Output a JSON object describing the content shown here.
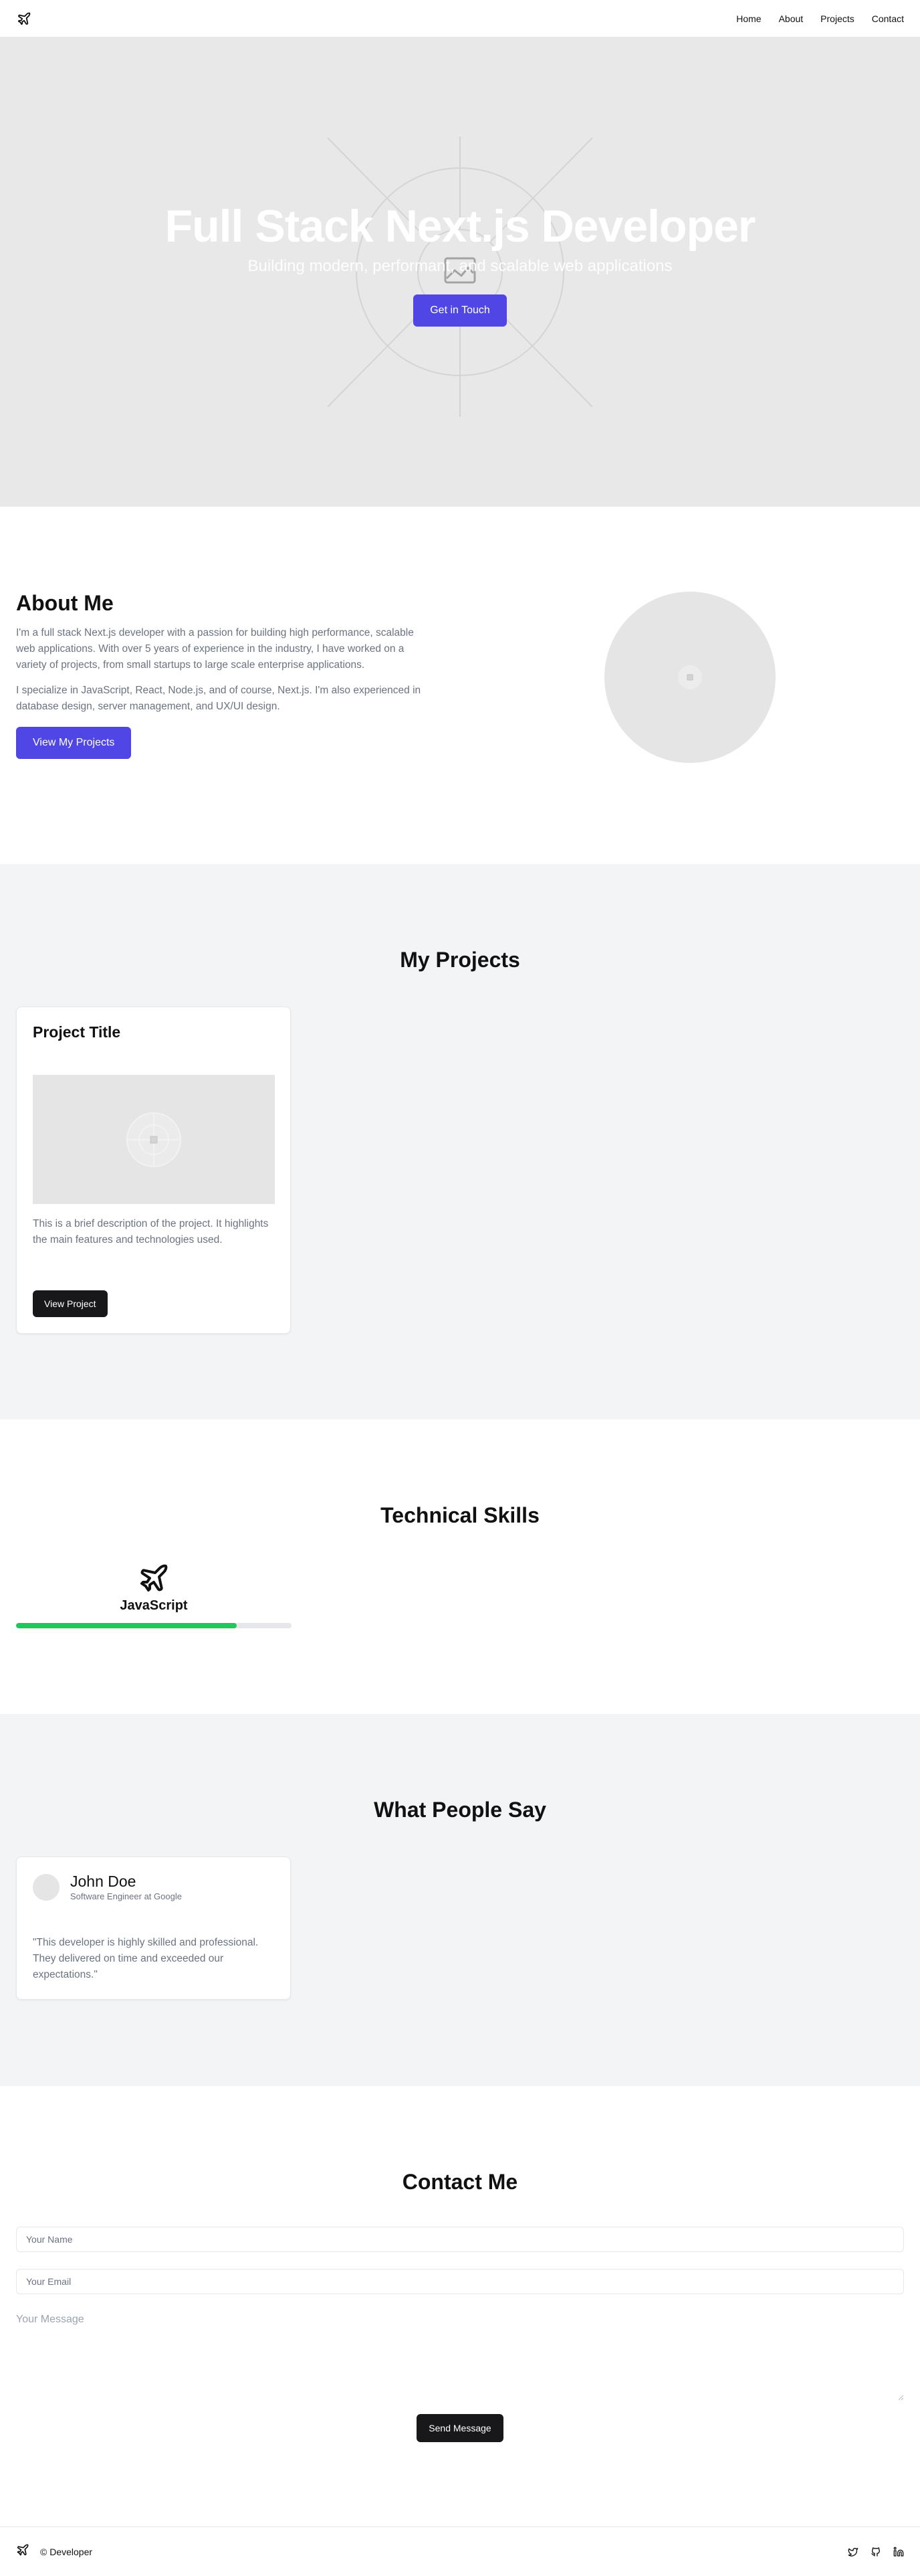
{
  "nav": {
    "logo_icon": "plane-icon",
    "links": [
      "Home",
      "About",
      "Projects",
      "Contact"
    ]
  },
  "hero": {
    "title": "Full Stack Next.js Developer",
    "subtitle": "Building modern, performant, and scalable web applications",
    "cta": "Get in Touch"
  },
  "about": {
    "title": "About Me",
    "p1": "I'm a full stack Next.js developer with a passion for building high performance, scalable web applications. With over 5 years of experience in the industry, I have worked on a variety of projects, from small startups to large scale enterprise applications.",
    "p2": "I specialize in JavaScript, React, Node.js, and of course, Next.js. I'm also experienced in database design, server management, and UX/UI design.",
    "cta": "View My Projects"
  },
  "projects": {
    "title": "My Projects",
    "items": [
      {
        "title": "Project Title",
        "description": "This is a brief description of the project. It highlights the main features and technologies used.",
        "cta": "View Project"
      }
    ]
  },
  "skills": {
    "title": "Technical Skills",
    "items": [
      {
        "name": "JavaScript",
        "icon": "plane-icon",
        "level": 0.8
      }
    ]
  },
  "testimonials": {
    "title": "What People Say",
    "items": [
      {
        "name": "John Doe",
        "role": "Software Engineer at Google",
        "quote": "\"This developer is highly skilled and professional. They delivered on time and exceeded our expectations.\""
      }
    ]
  },
  "contact": {
    "title": "Contact Me",
    "name_placeholder": "Your Name",
    "email_placeholder": "Your Email",
    "message_placeholder": "Your Message",
    "submit": "Send Message"
  },
  "footer": {
    "copyright": "© Developer",
    "socials": [
      "twitter-icon",
      "github-icon",
      "linkedin-icon"
    ]
  },
  "colors": {
    "accent": "#4f46e5",
    "dark_button": "#18181b",
    "skill_bar": "#22c55e",
    "section_gray": "#f3f4f6"
  }
}
